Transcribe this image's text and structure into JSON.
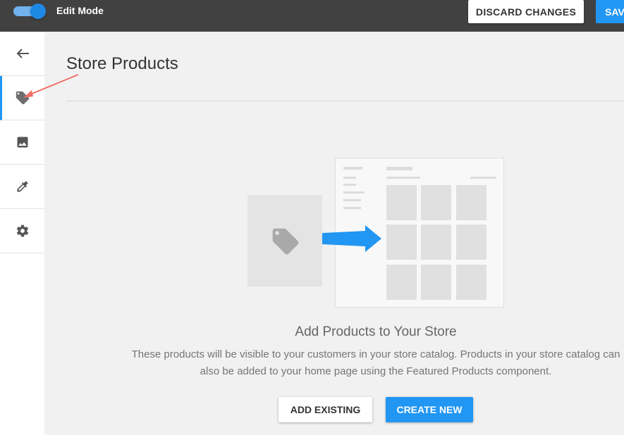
{
  "topbar": {
    "edit_mode_label": "Edit Mode",
    "edit_mode_on": true,
    "discard_label": "DISCARD CHANGES",
    "save_label": "SAV"
  },
  "sidebar": {
    "items": [
      {
        "name": "back",
        "icon": "arrow-left-icon"
      },
      {
        "name": "products",
        "icon": "tag-icon",
        "active": true
      },
      {
        "name": "images",
        "icon": "image-icon"
      },
      {
        "name": "colors",
        "icon": "eyedropper-icon"
      },
      {
        "name": "settings",
        "icon": "gear-icon"
      }
    ]
  },
  "main": {
    "title": "Store Products",
    "empty_state": {
      "heading": "Add Products to Your Store",
      "description": "These products will be visible to your customers in your store catalog. Products in your store catalog can also be added to your home page using the Featured Products component.",
      "illustration_icons": [
        "tag-icon",
        "arrow-right-icon"
      ]
    },
    "actions": {
      "add_existing_label": "ADD EXISTING",
      "create_new_label": "CREATE NEW"
    }
  },
  "colors": {
    "topbar_bg": "#414141",
    "accent": "#2196f3",
    "page_bg": "#f1f1f1",
    "annotation_arrow": "#f0706a"
  }
}
